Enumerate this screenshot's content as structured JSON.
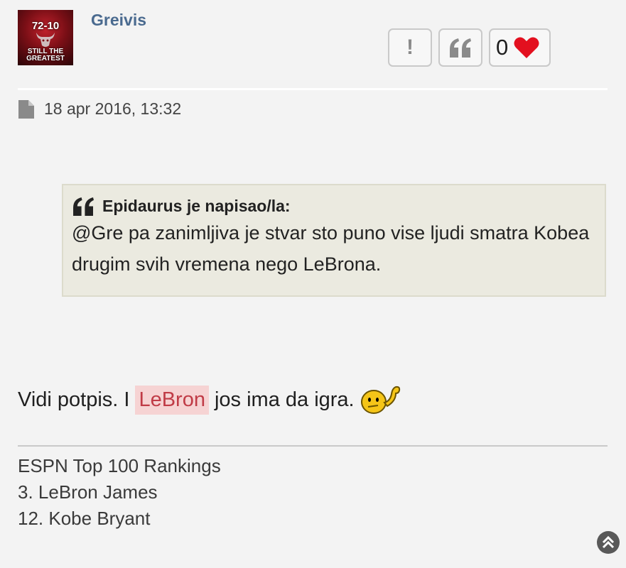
{
  "post": {
    "username": "Greivis",
    "avatar": {
      "top_text": "72-10",
      "bottom_text_line1": "STILL THE",
      "bottom_text_line2": "GREATEST"
    },
    "actions": {
      "report_icon": "exclamation-icon",
      "quote_icon": "quote-icon",
      "like_count": "0",
      "like_icon": "heart-icon"
    },
    "date": "18 apr 2016, 13:32",
    "date_icon": "document-icon",
    "quote": {
      "author_line": "Epidaurus je napisao/la:",
      "text": "@Gre pa zanimljiva je stvar sto puno vise ljudi smatra Kobea drugim svih vremena nego LeBrona."
    },
    "body": {
      "before": "Vidi potpis. I",
      "highlight": "LeBron",
      "after": "jos ima da igra.",
      "emoji": "thinking-flex-smiley-icon"
    },
    "signature": {
      "line1": "ESPN Top 100 Rankings",
      "line2": "3. LeBron James",
      "line3": "12. Kobe Bryant"
    },
    "colors": {
      "username": "#4a6a8f",
      "highlight_bg": "#f6d3d3",
      "highlight_text": "#c03b46",
      "heart": "#e3101f",
      "quote_bg": "#ebeae0"
    }
  }
}
